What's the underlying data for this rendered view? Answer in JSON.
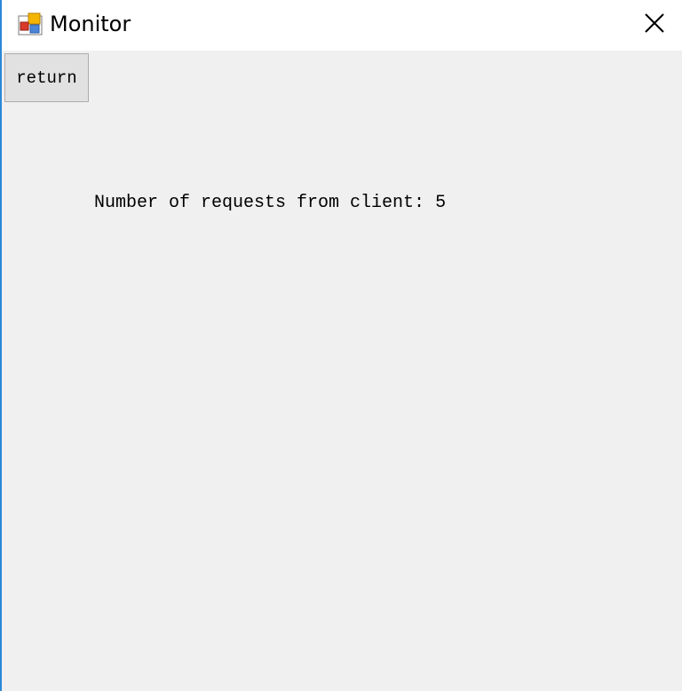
{
  "window": {
    "title": "Monitor",
    "app_icon": "winforms-app-icon",
    "close_icon": "close-x-icon",
    "accent_border_color": "#2b88d8",
    "background_color": "#f0f0f0"
  },
  "toolbar": {
    "return_label": "return"
  },
  "main": {
    "requests_text": "Number of requests from client: 5"
  }
}
